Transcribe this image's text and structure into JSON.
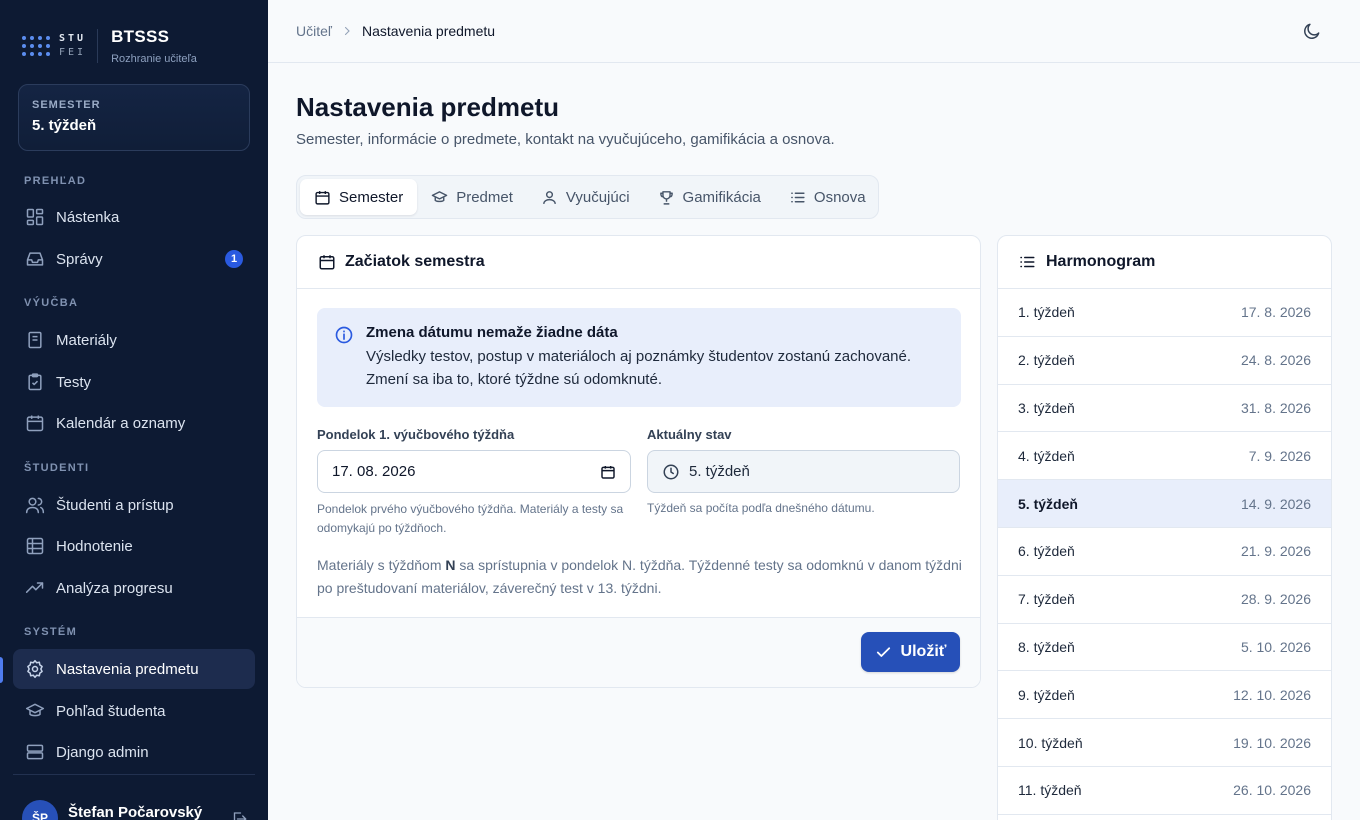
{
  "brand": {
    "logo_line1": "STU",
    "logo_line2": "FEI",
    "app_name": "BTSSS",
    "app_subtitle": "Rozhranie učiteľa"
  },
  "semester_card": {
    "label": "SEMESTER",
    "value": "5. týždeň"
  },
  "sidebar": {
    "sections": {
      "overview": "PREHĽAD",
      "teaching": "VÝUČBA",
      "students": "ŠTUDENTI",
      "system": "SYSTÉM"
    },
    "items": [
      {
        "label": "Nástenka",
        "icon": "dashboard-icon"
      },
      {
        "label": "Správy",
        "icon": "inbox-icon",
        "badge": "1"
      },
      {
        "label": "Materiály",
        "icon": "book-icon"
      },
      {
        "label": "Testy",
        "icon": "clipboard-check-icon"
      },
      {
        "label": "Kalendár a oznamy",
        "icon": "calendar-icon"
      },
      {
        "label": "Študenti a prístup",
        "icon": "users-icon"
      },
      {
        "label": "Hodnotenie",
        "icon": "grid-table-icon"
      },
      {
        "label": "Analýza progresu",
        "icon": "trending-up-icon"
      },
      {
        "label": "Nastavenia predmetu",
        "icon": "gear-icon",
        "active": true
      },
      {
        "label": "Pohľad študenta",
        "icon": "graduation-cap-icon"
      },
      {
        "label": "Django admin",
        "icon": "server-icon"
      }
    ]
  },
  "user": {
    "initials": "ŠP",
    "name": "Štefan Počarovský"
  },
  "breadcrumb": {
    "parent": "Učiteľ",
    "current": "Nastavenia predmetu"
  },
  "page": {
    "title": "Nastavenia predmetu",
    "subtitle": "Semester, informácie o predmete, kontakt na vyučujúceho, gamifikácia a osnova."
  },
  "tabs": [
    {
      "label": "Semester",
      "icon": "calendar-icon",
      "active": true
    },
    {
      "label": "Predmet",
      "icon": "graduation-cap-icon"
    },
    {
      "label": "Vyučujúci",
      "icon": "user-icon"
    },
    {
      "label": "Gamifikácia",
      "icon": "trophy-icon"
    },
    {
      "label": "Osnova",
      "icon": "list-icon"
    }
  ],
  "semester_form": {
    "title": "Začiatok semestra",
    "alert_title": "Zmena dátumu nemaže žiadne dáta",
    "alert_text": "Výsledky testov, postup v materiáloch aj poznámky študentov zostanú zachované. Zmení sa iba to, ktoré týždne sú odomknuté.",
    "start_label": "Pondelok 1. výučbového týždňa",
    "start_value": "17. 08. 2026",
    "start_hint": "Pondelok prvého výučbového týždňa. Materiály a testy sa odomykajú po týždňoch.",
    "status_label": "Aktuálny stav",
    "status_value": "5. týždeň",
    "status_hint": "Týždeň sa počíta podľa dnešného dátumu.",
    "note_before": "Materiály s týždňom ",
    "note_bold": "N",
    "note_after": " sa sprístupnia v pondelok N. týždňa. Týždenné testy sa odomknú v danom týždni po preštudovaní materiálov, záverečný test v 13. týždni.",
    "save_label": "Uložiť"
  },
  "schedule": {
    "title": "Harmonogram",
    "rows": [
      {
        "week": "1. týždeň",
        "date": "17. 8. 2026"
      },
      {
        "week": "2. týždeň",
        "date": "24. 8. 2026"
      },
      {
        "week": "3. týždeň",
        "date": "31. 8. 2026"
      },
      {
        "week": "4. týždeň",
        "date": "7. 9. 2026"
      },
      {
        "week": "5. týždeň",
        "date": "14. 9. 2026",
        "current": true
      },
      {
        "week": "6. týždeň",
        "date": "21. 9. 2026"
      },
      {
        "week": "7. týždeň",
        "date": "28. 9. 2026"
      },
      {
        "week": "8. týždeň",
        "date": "5. 10. 2026"
      },
      {
        "week": "9. týždeň",
        "date": "12. 10. 2026"
      },
      {
        "week": "10. týždeň",
        "date": "19. 10. 2026"
      },
      {
        "week": "11. týždeň",
        "date": "26. 10. 2026"
      }
    ]
  },
  "colors": {
    "sidebar_bg": "#0d1a33",
    "accent": "#2650b8",
    "highlight": "#e8eefb"
  }
}
